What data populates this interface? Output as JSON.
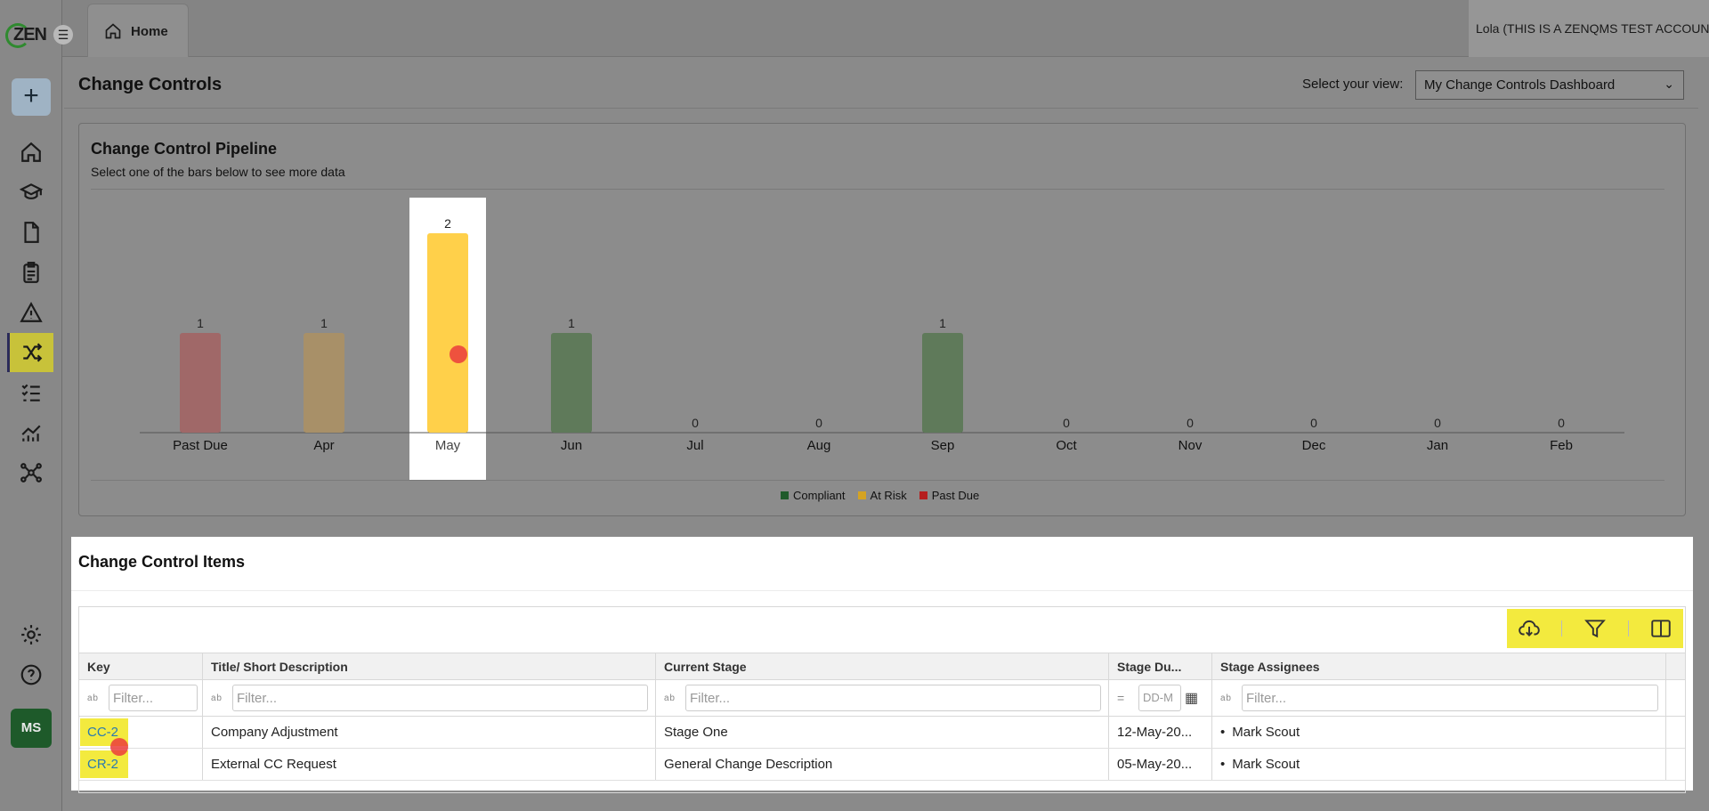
{
  "app": {
    "logo_text": "ZEN",
    "home_tab_label": "Home",
    "user_label": "Lola (THIS IS A ZENQMS TEST ACCOUNT)",
    "avatar_initials": "MS"
  },
  "sidebar": {
    "items": [
      {
        "icon": "home-icon"
      },
      {
        "icon": "training-cap-icon"
      },
      {
        "icon": "document-icon"
      },
      {
        "icon": "clipboard-icon"
      },
      {
        "icon": "warning-icon"
      },
      {
        "icon": "shuffle-icon",
        "active": true
      },
      {
        "icon": "checklist-icon"
      },
      {
        "icon": "analytics-icon"
      },
      {
        "icon": "network-icon"
      },
      {
        "icon": "gear-icon"
      },
      {
        "icon": "help-icon"
      }
    ]
  },
  "header": {
    "title": "Change Controls",
    "view_label": "Select your view:",
    "view_selected": "My Change Controls Dashboard"
  },
  "pipeline": {
    "title": "Change Control Pipeline",
    "subtitle": "Select one of the bars below to see more data"
  },
  "chart_data": {
    "type": "bar",
    "categories": [
      "Past Due",
      "Apr",
      "May",
      "Jun",
      "Jul",
      "Aug",
      "Sep",
      "Oct",
      "Nov",
      "Dec",
      "Jan",
      "Feb"
    ],
    "values": [
      1,
      1,
      2,
      1,
      0,
      0,
      1,
      0,
      0,
      0,
      0,
      0
    ],
    "bar_status": [
      "Past Due",
      "At Risk",
      "At Risk",
      "Compliant",
      "",
      "",
      "Compliant",
      "",
      "",
      "",
      "",
      ""
    ],
    "highlighted_category": "May",
    "ylim": [
      0,
      2
    ],
    "legend": [
      {
        "name": "Compliant",
        "color": "#1f5a2a"
      },
      {
        "name": "At Risk",
        "color": "#d4a323"
      },
      {
        "name": "Past Due",
        "color": "#b51e1e"
      }
    ],
    "legend_position": "bottom",
    "colors": {
      "Past Due": "#a06868",
      "At Risk": "#a89068",
      "At Risk Highlighted": "#ffd04a",
      "Compliant": "#5f7a5a"
    }
  },
  "items": {
    "title": "Change Control Items",
    "columns": [
      "Key",
      "Title/ Short Description",
      "Current Stage",
      "Stage Du...",
      "Stage Assignees"
    ],
    "filter_placeholder": "Filter...",
    "date_placeholder": "DD-M",
    "rows": [
      {
        "key": "CC-2",
        "title": "Company Adjustment",
        "stage": "Stage One",
        "due": "12-May-20...",
        "assignee": "Mark Scout"
      },
      {
        "key": "CR-2",
        "title": "External CC Request",
        "stage": "General Change Description",
        "due": "05-May-20...",
        "assignee": "Mark Scout"
      }
    ]
  },
  "toolbar": {
    "icons": [
      "cloud-download-icon",
      "filter-icon",
      "columns-icon"
    ]
  }
}
